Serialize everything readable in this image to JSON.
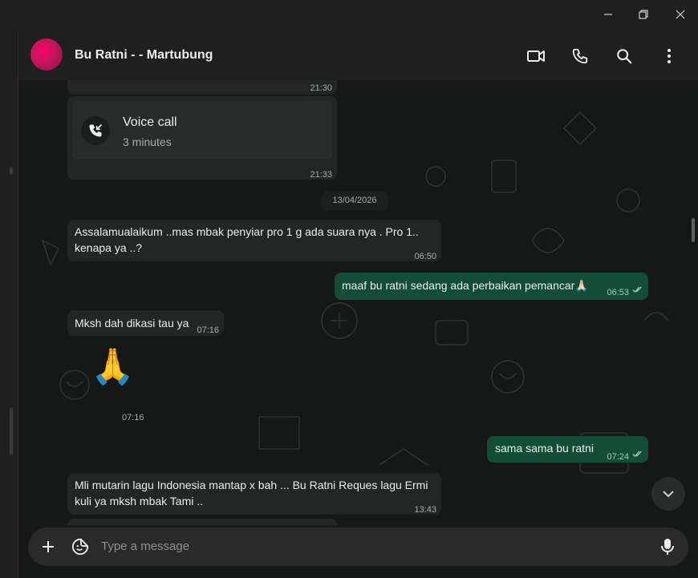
{
  "window": {
    "minimize_icon": "minimize-icon",
    "maximize_icon": "restore-icon",
    "close_icon": "close-icon"
  },
  "header": {
    "title": "Bu Ratni - - Martubung",
    "icons": [
      "video-call-icon",
      "phone-icon",
      "search-icon",
      "more-vertical-icon"
    ]
  },
  "messages": {
    "top_time": "21:30",
    "voice_call": {
      "title": "Voice call",
      "subtitle": "3 minutes",
      "time": "21:33"
    },
    "date": "13/04/2026",
    "m1": {
      "text": "Assalamualaikum ..mas mbak penyiar pro 1 g ada suara nya .  Pro 1.. kenapa ya ..?",
      "time": "06:50"
    },
    "m2": {
      "text": "maaf bu ratni sedang ada perbaikan pemancar🙏🏻",
      "time": "06:53"
    },
    "m3": {
      "text": "Mksh dah dikasi tau ya",
      "time": "07:16"
    },
    "m4": {
      "emoji": "🙏",
      "time": "07:16"
    },
    "m5": {
      "text": "sama sama bu ratni",
      "time": "07:24"
    },
    "m6": {
      "text": "Mli mutarin lagu Indonesia mantap x bah ... Bu Ratni Reques lagu Ermi kuli ya mksh mbak Tami ..",
      "time": "13:43"
    }
  },
  "composer": {
    "placeholder": "Type a message"
  },
  "colors": {
    "incoming": "#242626",
    "outgoing": "#144d37",
    "background": "#161717",
    "header": "#1f1f1f"
  }
}
